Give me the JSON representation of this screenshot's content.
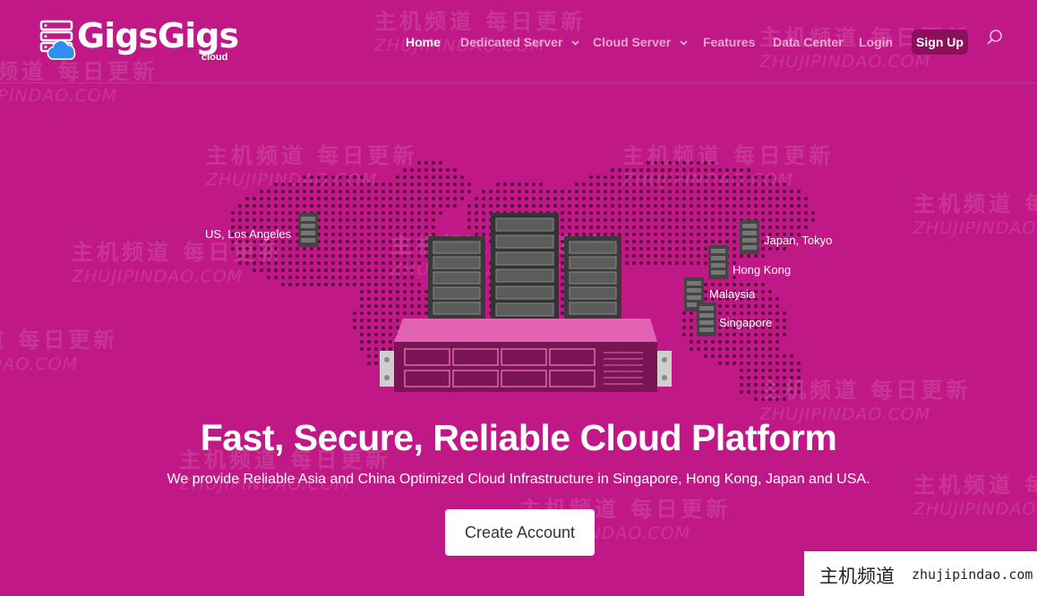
{
  "brand": {
    "name": "GigsGigs",
    "sub": "cloud"
  },
  "nav": {
    "items": [
      {
        "label": "Home",
        "active": true
      },
      {
        "label": "Dedicated Server",
        "dropdown": true
      },
      {
        "label": "Cloud Server",
        "dropdown": true
      },
      {
        "label": "Features"
      },
      {
        "label": "Data Center"
      },
      {
        "label": "Login"
      }
    ],
    "signup_label": "Sign Up"
  },
  "locations": [
    {
      "label": "US, Los Angeles"
    },
    {
      "label": "Japan, Tokyo"
    },
    {
      "label": "Hong Kong"
    },
    {
      "label": "Malaysia"
    },
    {
      "label": "Singapore"
    }
  ],
  "hero": {
    "title": "Fast, Secure, Reliable Cloud Platform",
    "subtitle": "We provide Reliable Asia and China Optimized Cloud Infrastructure in Singapore, Hong Kong, Japan and USA.",
    "cta_label": "Create Account"
  },
  "watermark": {
    "cn": "主机频道 每日更新",
    "en": "ZHUJIPINDAO.COM"
  },
  "corner_badge": {
    "cn": "主机频道",
    "en": "zhujipindao.com"
  },
  "colors": {
    "background": "#c01886",
    "signup_bg": "#8b0f5d",
    "accent_box": "#e263b4"
  }
}
